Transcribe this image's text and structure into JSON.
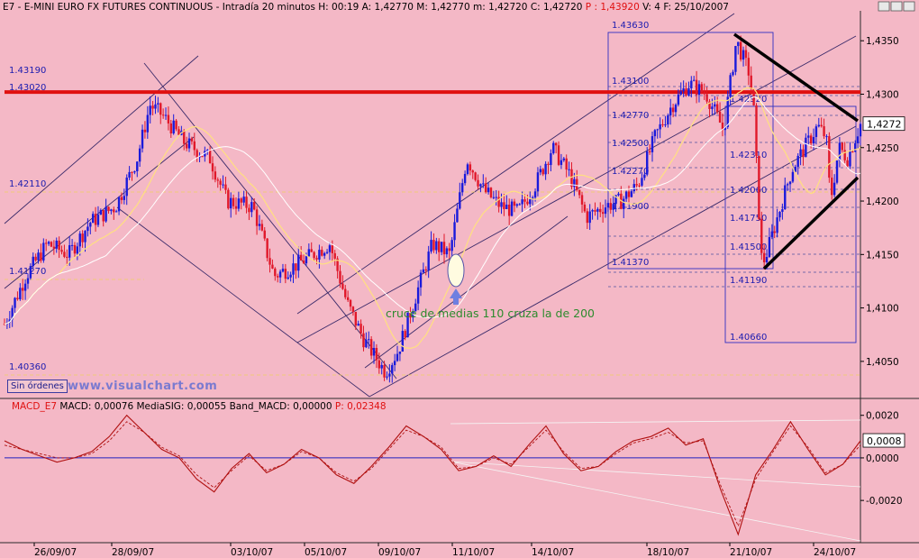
{
  "header": {
    "symbol": "E7",
    "name": "E-MINI EURO FX FUTURES CONTINUOUS",
    "stats": "Intradía 20 minutos  H: 00:19  A: 1,42770  M: 1,42770  m: 1,42720  C: 1,42720",
    "p_value": "P : 1,43920",
    "tail": "V: 4  F: 25/10/2007"
  },
  "macd_header": {
    "symbol": "MACD_E7",
    "stats": "MACD: 0,00076  MediaSIG: 0,00055  Band_MACD: 0,00000",
    "p_value": "P: 0,02348"
  },
  "badge": "Sin órdenes",
  "watermark": "www.visualchart.com",
  "annotation": "cruce de medias 110 cruza la de 200",
  "levels_left": [
    "1.43190",
    "1.43020",
    "1.42110",
    "1.41270",
    "1.40360"
  ],
  "levels_box1": [
    "1.43630",
    "1.43100",
    "1.42770",
    "1.42500",
    "1.42270",
    "1.41900",
    "1.41370"
  ],
  "levels_box2": [
    "1.42920",
    "1.42310",
    "1.42060",
    "1.41750",
    "1.41500",
    "1.41190",
    "1.40660"
  ],
  "price_readout": "1,4272",
  "macd_readout": "0,0008",
  "colors": {
    "background": "#f4b8c6",
    "up_candle": "#1a1adb",
    "down_candle": "#e0182a",
    "resistance": "#e01010",
    "ma_fast": "#ffe080",
    "ma_slow": "#ffffff",
    "channel": "#3a2a6a",
    "macd": "#b01010",
    "signal": "#b01010",
    "zero_line": "#2020c0",
    "triangle": "#000000"
  },
  "chart_data": [
    {
      "type": "candlestick",
      "title": "E7 - E-MINI EURO FX FUTURES CONTINUOUS - Intradía 20 minutos",
      "x_tick_labels": [
        "26/09/07",
        "28/09/07",
        "03/10/07",
        "05/10/07",
        "09/10/07",
        "11/10/07",
        "14/10/07",
        "18/10/07",
        "21/10/07",
        "24/10/07"
      ],
      "y_tick_labels": [
        "1,4350",
        "1,4300",
        "1,4250",
        "1,4200",
        "1,4150",
        "1,4100",
        "1,4050"
      ],
      "ylim": [
        1.4017,
        1.4378
      ],
      "resistance_level": 1.4302,
      "last_price": 1.4272,
      "close_path": [
        [
          0.0,
          1.4085
        ],
        [
          0.025,
          1.413
        ],
        [
          0.05,
          1.416
        ],
        [
          0.075,
          1.415
        ],
        [
          0.1,
          1.418
        ],
        [
          0.13,
          1.4195
        ],
        [
          0.155,
          1.424
        ],
        [
          0.17,
          1.429
        ],
        [
          0.185,
          1.428
        ],
        [
          0.21,
          1.4255
        ],
        [
          0.24,
          1.424
        ],
        [
          0.26,
          1.42
        ],
        [
          0.29,
          1.4195
        ],
        [
          0.315,
          1.413
        ],
        [
          0.34,
          1.414
        ],
        [
          0.36,
          1.415
        ],
        [
          0.38,
          1.416
        ],
        [
          0.4,
          1.4105
        ],
        [
          0.42,
          1.407
        ],
        [
          0.445,
          1.404
        ],
        [
          0.46,
          1.406
        ],
        [
          0.48,
          1.411
        ],
        [
          0.5,
          1.416
        ],
        [
          0.52,
          1.415
        ],
        [
          0.54,
          1.424
        ],
        [
          0.56,
          1.421
        ],
        [
          0.58,
          1.4195
        ],
        [
          0.6,
          1.419
        ],
        [
          0.62,
          1.4215
        ],
        [
          0.64,
          1.425
        ],
        [
          0.66,
          1.4225
        ],
        [
          0.68,
          1.4185
        ],
        [
          0.7,
          1.4195
        ],
        [
          0.72,
          1.42
        ],
        [
          0.74,
          1.4215
        ],
        [
          0.76,
          1.426
        ],
        [
          0.78,
          1.429
        ],
        [
          0.8,
          1.431
        ],
        [
          0.82,
          1.43
        ],
        [
          0.835,
          1.4275
        ],
        [
          0.84,
          1.4265
        ],
        [
          0.855,
          1.435
        ],
        [
          0.87,
          1.432
        ],
        [
          0.875,
          1.429
        ],
        [
          0.88,
          1.421
        ],
        [
          0.885,
          1.414
        ],
        [
          0.89,
          1.415
        ],
        [
          0.905,
          1.419
        ],
        [
          0.92,
          1.423
        ],
        [
          0.935,
          1.425
        ],
        [
          0.95,
          1.427
        ],
        [
          0.96,
          1.426
        ],
        [
          0.965,
          1.42
        ],
        [
          0.975,
          1.425
        ],
        [
          0.985,
          1.424
        ],
        [
          1.0,
          1.4272
        ]
      ]
    },
    {
      "type": "line",
      "title": "MACD_E7",
      "y_tick_labels": [
        "0,0020",
        "0,0000",
        "-0,0020"
      ],
      "ylim": [
        -0.0039,
        0.0022
      ],
      "series": [
        {
          "name": "MACD",
          "values": [
            0.0008,
            0.0004,
            0.0001,
            -0.0002,
            0.0,
            0.0003,
            0.001,
            0.002,
            0.0012,
            0.0004,
            0.0,
            -0.001,
            -0.0016,
            -0.0005,
            0.0002,
            -0.0007,
            -0.0003,
            0.0004,
            0.0,
            -0.0008,
            -0.0012,
            -0.0004,
            0.0005,
            0.0015,
            0.001,
            0.0004,
            -0.0006,
            -0.0004,
            0.0001,
            -0.0004,
            0.0006,
            0.0015,
            0.0002,
            -0.0006,
            -0.0004,
            0.0003,
            0.0008,
            0.001,
            0.0014,
            0.0006,
            0.0009,
            -0.0015,
            -0.0036,
            -0.0008,
            0.0004,
            0.0017,
            0.0004,
            -0.0008,
            -0.0003,
            0.0008
          ]
        },
        {
          "name": "MediaSIG",
          "values": [
            0.0006,
            0.0004,
            0.0002,
            0.0,
            0.0,
            0.0002,
            0.0008,
            0.0017,
            0.0012,
            0.0005,
            0.0001,
            -0.0008,
            -0.0014,
            -0.0006,
            0.0001,
            -0.0006,
            -0.0003,
            0.0003,
            0.0,
            -0.0007,
            -0.0011,
            -0.0005,
            0.0004,
            0.0013,
            0.001,
            0.0005,
            -0.0005,
            -0.0004,
            0.0,
            -0.0003,
            0.0005,
            0.0013,
            0.0003,
            -0.0005,
            -0.0004,
            0.0002,
            0.0007,
            0.0009,
            0.0012,
            0.0007,
            0.0008,
            -0.0013,
            -0.0032,
            -0.001,
            0.0003,
            0.0015,
            0.0005,
            -0.0007,
            -0.0003,
            0.0006
          ]
        }
      ]
    }
  ]
}
